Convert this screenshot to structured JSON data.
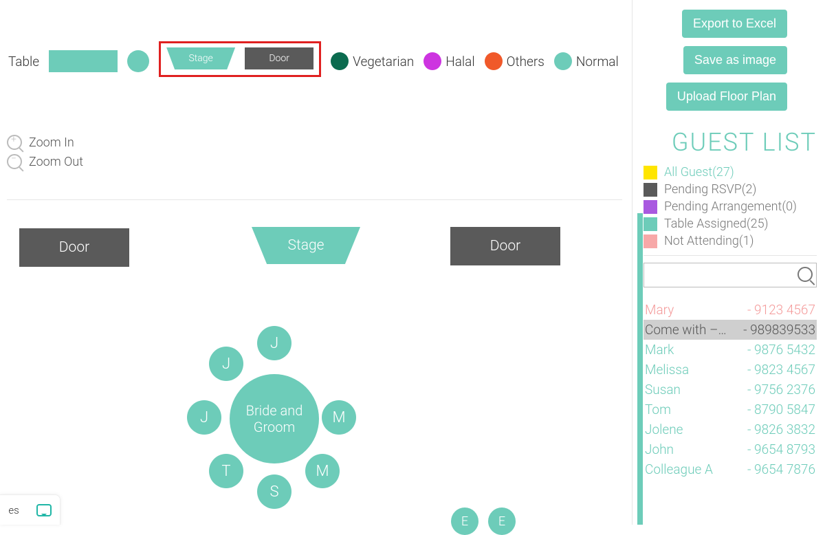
{
  "legend": {
    "table_label": "Table",
    "stage_label": "Stage",
    "door_label": "Door",
    "diet": {
      "vegetarian": "Vegetarian",
      "halal": "Halal",
      "others": "Others",
      "normal": "Normal"
    }
  },
  "buttons": {
    "export_excel": "Export to Excel",
    "save_image": "Save as image",
    "upload_floorplan": "Upload Floor Plan"
  },
  "zoom": {
    "in_label": "Zoom In",
    "out_label": "Zoom Out"
  },
  "floorplan": {
    "door_left": "Door",
    "door_right": "Door",
    "stage": "Stage",
    "main_table_line1": "Bride and",
    "main_table_line2": "Groom",
    "seats": [
      "J",
      "J",
      "J",
      "M",
      "T",
      "S",
      "M"
    ],
    "small_seats": [
      "E",
      "E"
    ]
  },
  "guestlist": {
    "title": "GUEST LIST",
    "statuses": {
      "all": "All Guest(27)",
      "pending_rsvp": "Pending RSVP(2)",
      "pending_arr": "Pending Arrangement(0)",
      "assigned": "Table Assigned(25)",
      "not_attending": "Not Attending(1)"
    },
    "search_value": "",
    "guests": [
      {
        "name": "Mary",
        "phone": "- 9123 4567",
        "style": "pink"
      },
      {
        "name": "Come with –…",
        "phone": "- 989839533",
        "style": "grey"
      },
      {
        "name": "Mark",
        "phone": "- 9876 5432",
        "style": ""
      },
      {
        "name": "Melissa",
        "phone": "- 9823 4567",
        "style": ""
      },
      {
        "name": "Susan",
        "phone": "- 9756 2376",
        "style": ""
      },
      {
        "name": "Tom",
        "phone": "- 8790 5847",
        "style": ""
      },
      {
        "name": "Jolene",
        "phone": "- 9826 3832",
        "style": ""
      },
      {
        "name": "John",
        "phone": "- 9654 8793",
        "style": ""
      },
      {
        "name": "Colleague A",
        "phone": "- 9654 7876",
        "style": ""
      }
    ]
  },
  "chat": {
    "label": "es"
  }
}
